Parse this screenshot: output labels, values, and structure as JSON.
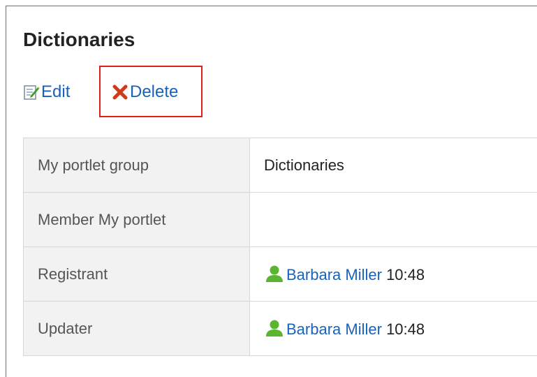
{
  "page": {
    "title": "Dictionaries"
  },
  "actions": {
    "edit": {
      "label": "Edit",
      "icon": "edit-icon"
    },
    "delete": {
      "label": "Delete",
      "icon": "delete-icon"
    }
  },
  "details": {
    "portlet_group": {
      "label": "My portlet group",
      "value": "Dictionaries"
    },
    "member_portlet": {
      "label": "Member My portlet",
      "value": ""
    },
    "registrant": {
      "label": "Registrant",
      "user": "Barbara Miller",
      "time": "10:48",
      "icon": "user-icon"
    },
    "updater": {
      "label": "Updater",
      "user": "Barbara Miller",
      "time": "10:48",
      "icon": "user-icon"
    }
  },
  "colors": {
    "link": "#1a62b9",
    "highlight": "#e0201c",
    "label_bg": "#f2f2f2",
    "user_icon": "#5cb531"
  }
}
